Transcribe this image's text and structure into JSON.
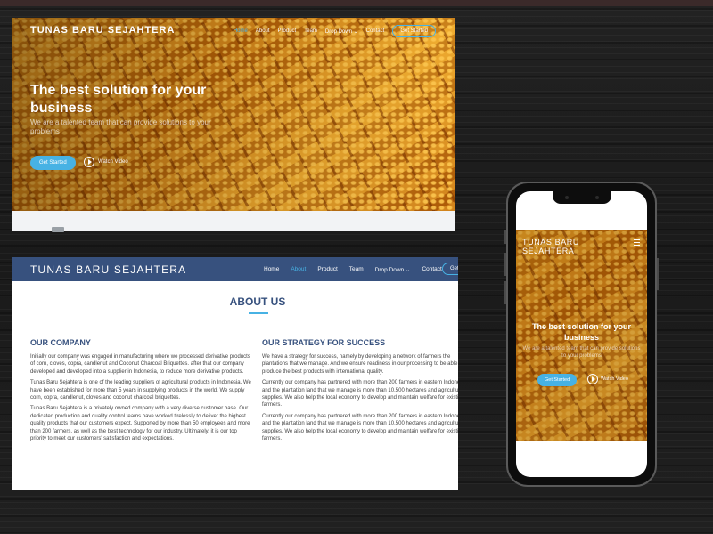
{
  "brand": "TUNAS BARU SEJAHTERA",
  "hero": {
    "nav": [
      "Home",
      "About",
      "Product",
      "Team",
      "Drop Down",
      "Contact"
    ],
    "nav_active": "Home",
    "get_started": "Get Started",
    "title": "The best solution for your business",
    "subtitle": "We are a talented team that can provide solutions to your problems",
    "cta": "Get Started",
    "watch": "Watch Video"
  },
  "about": {
    "nav": [
      "Home",
      "About",
      "Product",
      "Team",
      "Drop Down",
      "Contact"
    ],
    "nav_active": "About",
    "get_started": "Get",
    "heading": "ABOUT US",
    "company_title": "OUR COMPANY",
    "company_paragraphs": [
      "Initially our company was engaged in manufacturing where we processed derivative products of corn, cloves, copra, candlenut and Coconut Charcoal Briquettes. after that our company developed and developed into a supplier in Indonesia, to reduce more derivative products.",
      "Tunas Baru Sejahtera is one of the leading suppliers of agricultural products in Indonesia. We have been established for more than 5 years in supplying products in the world. We supply corn, copra, candlenut, cloves and coconut charcoal briquettes.",
      "Tunas Baru Sejahtera is a privately owned company with a very diverse customer base. Our dedicated production and quality control teams have worked tirelessly to deliver the highest quality products that our customers expect. Supported by more than 50 employees and more than 200 farmers, as well as the best technology for our industry. Ultimately, it is our top priority to meet our customers' satisfaction and expectations."
    ],
    "strategy_title": "OUR STRATEGY FOR SUCCESS",
    "strategy_paragraphs": [
      "We have a strategy for success, namely by developing a network of farmers the plantations that we manage. And we ensure readiness in our processing to be able to produce the best products with international quality.",
      "Currently our company has partnered with more than 200 farmers in eastern Indonesia, and the plantation land that we manage is more than 10,500 hectares and agricultural supplies. We also help the local economy to develop and maintain welfare for existing farmers.",
      "Currently our company has partnered with more than 200 farmers in eastern Indonesia, and the plantation land that we manage is more than 10,500 hectares and agricultural supplies. We also help the local economy to develop and maintain welfare for existing farmers."
    ]
  },
  "mobile": {
    "brand": "TUNAS BARU SEJAHTERA",
    "title": "The best solution for your business",
    "subtitle": "We are a talented team that can provide solutions to your problems",
    "cta": "Get Started",
    "watch": "Watch Video"
  },
  "colors": {
    "navy": "#37517e",
    "accent": "#47b2e4"
  }
}
